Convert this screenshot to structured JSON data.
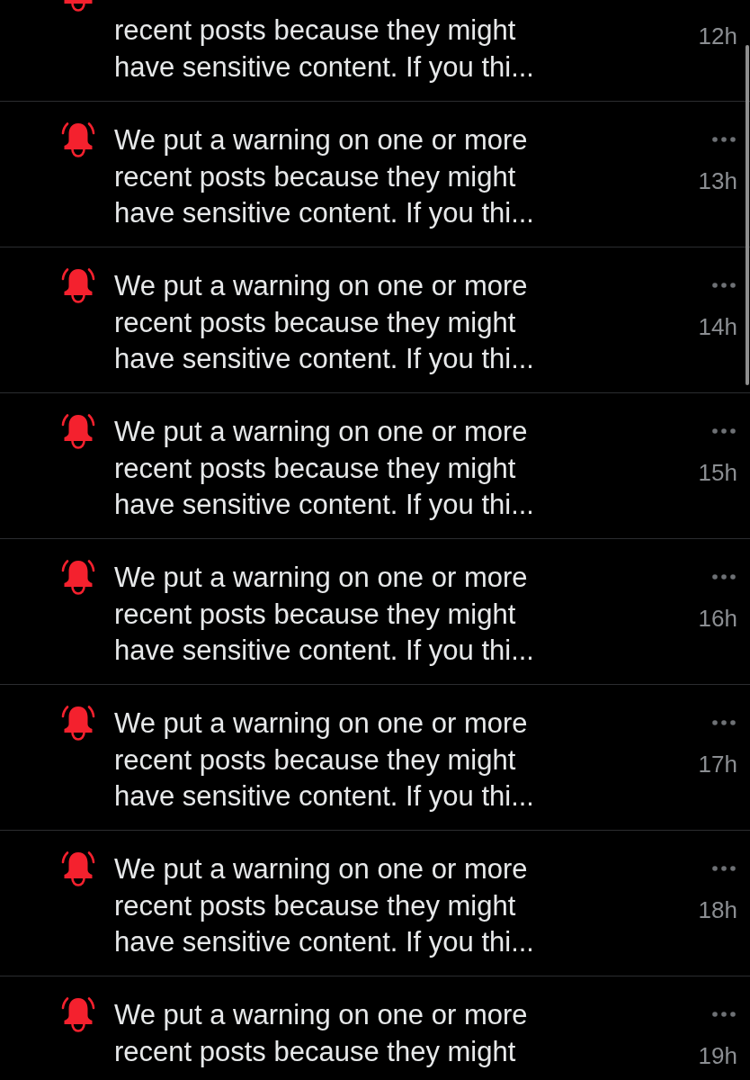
{
  "notifications": [
    {
      "kind": "clipped_top",
      "message": "recent posts because they might have sensitive content. If you thi...",
      "time": "12h"
    },
    {
      "kind": "full",
      "message": "We put a warning on one or more recent posts because they might have sensitive content. If you thi...",
      "time": "13h"
    },
    {
      "kind": "full",
      "message": "We put a warning on one or more recent posts because they might have sensitive content. If you thi...",
      "time": "14h"
    },
    {
      "kind": "full",
      "message": "We put a warning on one or more recent posts because they might have sensitive content. If you thi...",
      "time": "15h"
    },
    {
      "kind": "full",
      "message": "We put a warning on one or more recent posts because they might have sensitive content. If you thi...",
      "time": "16h"
    },
    {
      "kind": "full",
      "message": "We put a warning on one or more recent posts because they might have sensitive content. If you thi...",
      "time": "17h"
    },
    {
      "kind": "full",
      "message": "We put a warning on one or more recent posts because they might have sensitive content. If you thi...",
      "time": "18h"
    },
    {
      "kind": "clipped_bottom",
      "message": "We put a warning on one or more recent posts because they might",
      "time": "19h"
    }
  ]
}
